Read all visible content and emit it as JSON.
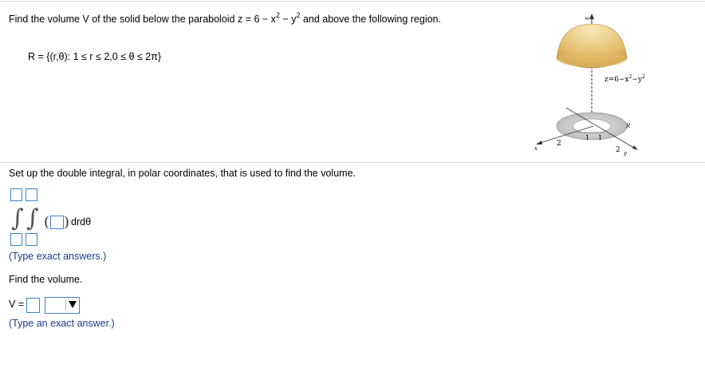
{
  "problem": {
    "text_a": "Find the volume V of the solid below the paraboloid z = 6 − x",
    "exp_a": "2",
    "text_b": " − y",
    "exp_b": "2",
    "text_c": " and above the following region.",
    "region": "R = {(r,θ): 1 ≤ r ≤ 2,0 ≤ θ ≤ 2π}"
  },
  "figure": {
    "z_axis": "z",
    "z_tick": "6",
    "surface_label": "z=6−x",
    "surface_exp1": "2",
    "surface_mid": "−y",
    "surface_exp2": "2",
    "region_label": "R",
    "x_axis": "x",
    "y_axis": "y",
    "x_tick": "2",
    "y_tick": "2",
    "inner_tick_1": "1",
    "inner_tick_2": "1"
  },
  "part1": {
    "prompt": "Set up the double integral, in polar coordinates, that is used to find the volume.",
    "integrand_suffix": "drdθ",
    "hint": "(Type exact answers.)",
    "fields": {
      "upper_outer": "",
      "upper_inner": "",
      "lower_outer": "",
      "lower_inner": "",
      "integrand": ""
    }
  },
  "part2": {
    "prompt": "Find the volume.",
    "v_label": "V =",
    "v_value": "",
    "units_selected": "",
    "hint": "(Type an exact answer.)"
  },
  "colors": {
    "field_border": "#3f83c9",
    "hint_text": "#1a3d8c",
    "paraboloid_top": "#f3e0a4",
    "paraboloid_bottom": "#d7a84a",
    "annulus": "#c9c9c9"
  }
}
